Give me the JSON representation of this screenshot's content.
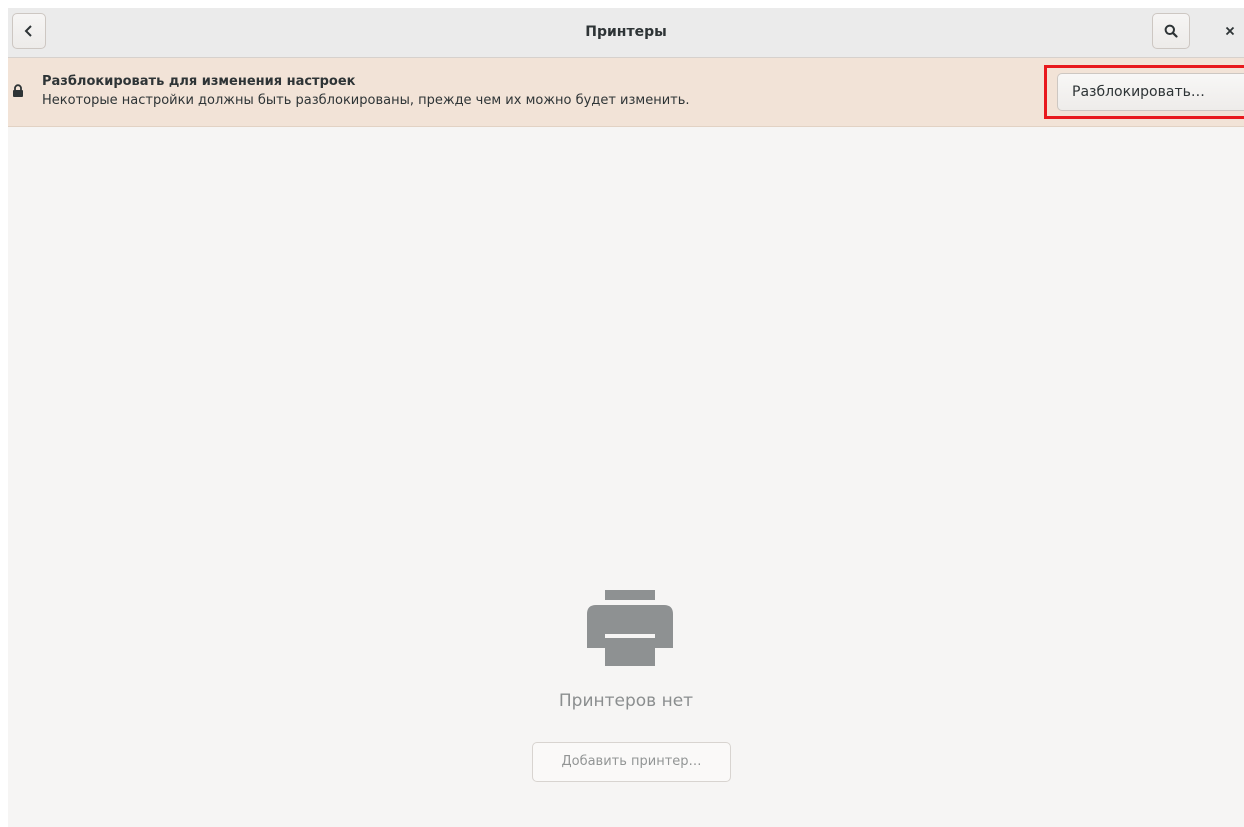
{
  "window": {
    "title": "Принтеры"
  },
  "header": {
    "back_icon": "chevron-left-icon",
    "search_icon": "search-icon",
    "close_icon": "close-icon"
  },
  "infobar": {
    "lock_icon": "lock-icon",
    "title": "Разблокировать для изменения настроек",
    "subtitle": "Некоторые настройки должны быть разблокированы, прежде чем их можно будет изменить.",
    "unlock_label": "Разблокировать…",
    "highlight_color": "#e8191d"
  },
  "empty_state": {
    "icon": "printer-icon",
    "label": "Принтеров нет",
    "add_printer_label": "Добавить принтер…"
  }
}
